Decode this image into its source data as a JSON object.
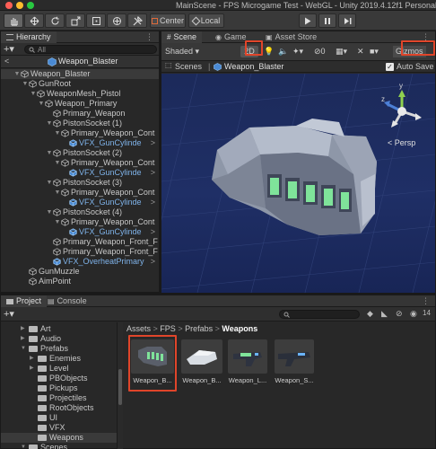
{
  "titlebar": {
    "title": "MainScene - FPS Microgame Test - WebGL - Unity 2019.4.12f1 Personal",
    "dots": [
      "#ff5f57",
      "#febc2e",
      "#28c840"
    ]
  },
  "toolbar": {
    "center_label": "Center",
    "local_label": "Local"
  },
  "hierarchy": {
    "tab_label": "Hierarchy",
    "search_placeholder": "All",
    "breadcrumb": "Weapon_Blaster",
    "rows": [
      {
        "label": "Weapon_Blaster",
        "prefab": false,
        "root": true
      },
      {
        "label": "GunRoot",
        "prefab": false
      },
      {
        "label": "WeaponMesh_Pistol",
        "prefab": false
      },
      {
        "label": "Weapon_Primary",
        "prefab": false
      },
      {
        "label": "Primary_Weapon",
        "prefab": false
      },
      {
        "label": "PistonSocket (1)",
        "prefab": false
      },
      {
        "label": "Primary_Weapon_Cont",
        "prefab": false
      },
      {
        "label": "VFX_GunCylinde",
        "prefab": true
      },
      {
        "label": "PistonSocket (2)",
        "prefab": false
      },
      {
        "label": "Primary_Weapon_Cont",
        "prefab": false
      },
      {
        "label": "VFX_GunCylinde",
        "prefab": true
      },
      {
        "label": "PistonSocket (3)",
        "prefab": false
      },
      {
        "label": "Primary_Weapon_Cont",
        "prefab": false
      },
      {
        "label": "VFX_GunCylinde",
        "prefab": true
      },
      {
        "label": "PistonSocket (4)",
        "prefab": false
      },
      {
        "label": "Primary_Weapon_Cont",
        "prefab": false
      },
      {
        "label": "VFX_GunCylinde",
        "prefab": true
      },
      {
        "label": "Primary_Weapon_Front_F",
        "prefab": false
      },
      {
        "label": "Primary_Weapon_Front_F",
        "prefab": false
      },
      {
        "label": "VFX_OverheatPrimary",
        "prefab": true
      },
      {
        "label": "GunMuzzle",
        "prefab": false
      },
      {
        "label": "AimPoint",
        "prefab": false
      }
    ]
  },
  "scene": {
    "tab_scene": "Scene",
    "tab_game": "Game",
    "tab_asset_store": "Asset Store",
    "shading_label": "Shaded",
    "toggle_2d": "2D",
    "hidden_count": "0",
    "gizmos_label": "Gizmos",
    "breadcrumb_root": "Scenes",
    "breadcrumb_item": "Weapon_Blaster",
    "auto_save_label": "Auto Save",
    "persp_label": "< Persp",
    "axis_y": "y",
    "axis_z": "z"
  },
  "project": {
    "tab_project": "Project",
    "tab_console": "Console",
    "count_label": "14",
    "path": [
      "Assets",
      "FPS",
      "Prefabs",
      "Weapons"
    ],
    "tree": [
      {
        "label": "Art",
        "depth": 1
      },
      {
        "label": "Audio",
        "depth": 1
      },
      {
        "label": "Prefabs",
        "depth": 1
      },
      {
        "label": "Enemies",
        "depth": 2
      },
      {
        "label": "Level",
        "depth": 2
      },
      {
        "label": "PBObjects",
        "depth": 2
      },
      {
        "label": "Pickups",
        "depth": 2
      },
      {
        "label": "Projectiles",
        "depth": 2
      },
      {
        "label": "RootObjects",
        "depth": 2
      },
      {
        "label": "UI",
        "depth": 2
      },
      {
        "label": "VFX",
        "depth": 2
      },
      {
        "label": "Weapons",
        "depth": 2
      },
      {
        "label": "Scenes",
        "depth": 1
      }
    ],
    "assets": [
      {
        "label": "Weapon_B..."
      },
      {
        "label": "Weapon_B..."
      },
      {
        "label": "Weapon_L..."
      },
      {
        "label": "Weapon_S..."
      }
    ]
  },
  "colors": {
    "highlight": "#e0452a",
    "prefab_text": "#7fb3ea",
    "selection": "#2c5d87"
  }
}
